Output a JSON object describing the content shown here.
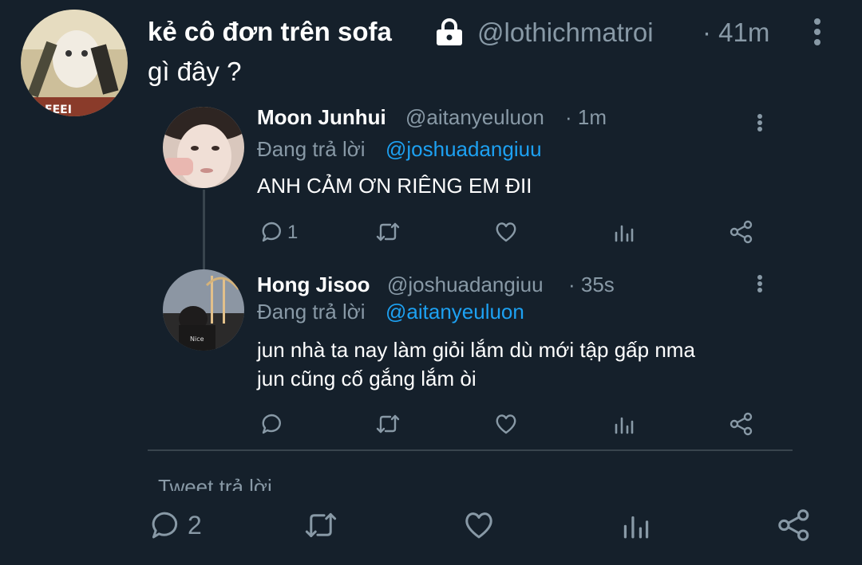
{
  "colors": {
    "background": "#15202b",
    "muted": "#8899a6",
    "link": "#1da1f2",
    "text": "#ffffff",
    "divider": "#38444d"
  },
  "main_tweet": {
    "display_name": "kẻ cô đơn trên sofa",
    "handle": "@lothichmatroi",
    "time": "· 41m",
    "text": "gì đây ?",
    "lock_icon": "lock-icon",
    "more_icon": "more-vertical-icon"
  },
  "quoted": {
    "tweet1": {
      "display_name": "Moon Junhui",
      "handle": "@aitanyeuluon",
      "time": "· 1m",
      "replying_label": "Đang trả lời",
      "replying_to": "@joshuadangiuu",
      "text": "ANH CẢM ƠN RIÊNG EM ĐII",
      "reply_count": "1"
    },
    "tweet2": {
      "display_name": "Hong Jisoo",
      "handle": "@joshuadangiuu",
      "time": "· 35s",
      "replying_label": "Đang trả lời",
      "replying_to": "@aitanyeuluon",
      "text_line1": "jun nhà ta nay làm giỏi lắm dù mới tập gấp nma",
      "text_line2": "jun cũng cố gắng lắm òi",
      "reply_count": ""
    }
  },
  "reply_prompt": "Tweet trả lời",
  "bottom_actions": {
    "reply_count": "2",
    "icons": [
      "reply-icon",
      "retweet-icon",
      "like-icon",
      "analytics-icon",
      "share-icon"
    ]
  }
}
